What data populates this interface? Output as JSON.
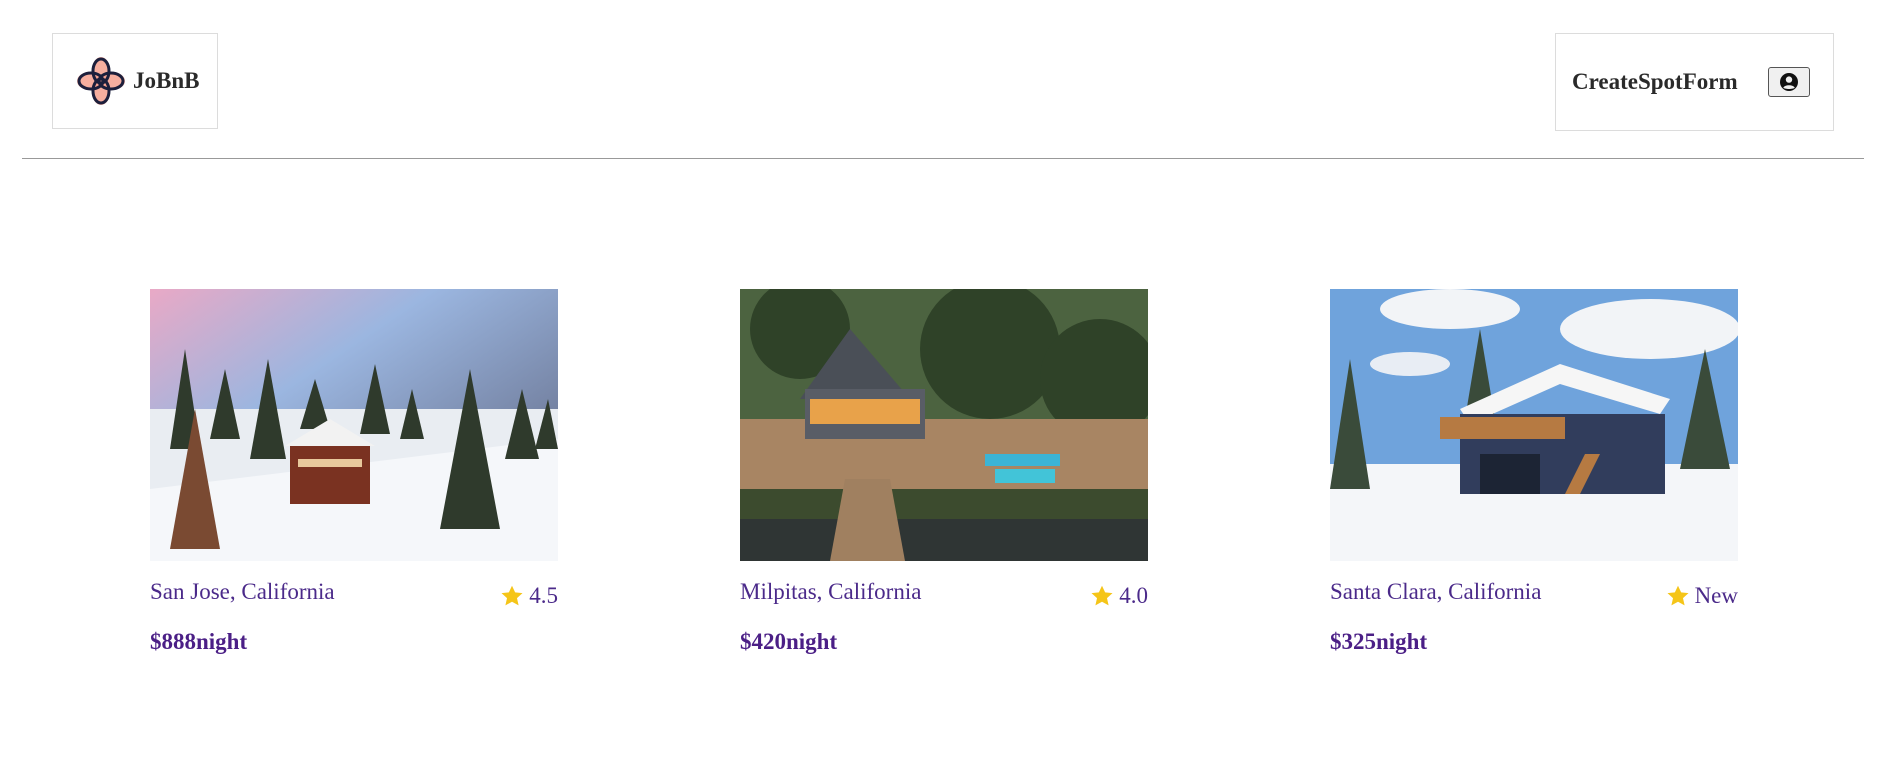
{
  "header": {
    "brand": "JoBnB",
    "create_link": "CreateSpotForm",
    "profile_icon": "user-circle-icon"
  },
  "colors": {
    "accent": "#4b2a8a",
    "star": "#f5c518",
    "divider": "#999999"
  },
  "spots": [
    {
      "location": "San Jose, California",
      "rating": "4.5",
      "price": "$888night",
      "image": "snowy-cabin-forest"
    },
    {
      "location": "Milpitas, California",
      "rating": "4.0",
      "price": "$420night",
      "image": "lake-house-dock"
    },
    {
      "location": "Santa Clara, California",
      "rating": "New",
      "price": "$325night",
      "image": "blue-chalet-snow"
    }
  ]
}
